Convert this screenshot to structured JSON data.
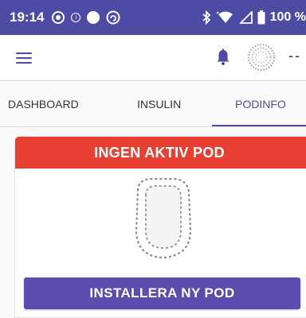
{
  "status_bar": {
    "time": "19:14",
    "battery_percent": "100 %",
    "icons": [
      "circle-dot-icon",
      "info-circle-icon",
      "solid-circle-icon",
      "sync-circle-icon",
      "bluetooth-icon",
      "wifi-icon",
      "signal-icon",
      "battery-icon"
    ]
  },
  "app_bar": {
    "trailing_text": "--",
    "icons": [
      "hamburger-menu-icon",
      "bell-icon",
      "pod-status-indicator-icon"
    ]
  },
  "tabs": [
    {
      "label": "DASHBOARD",
      "active": false
    },
    {
      "label": "INSULIN",
      "active": false
    },
    {
      "label": "PODINFO",
      "active": true
    }
  ],
  "pod_card": {
    "banner": "INGEN AKTIV POD",
    "install_button": "INSTALLERA NY POD"
  },
  "colors": {
    "primary": "#4e4ba5",
    "banner_red": "#e74032",
    "button": "#5b4cae"
  }
}
